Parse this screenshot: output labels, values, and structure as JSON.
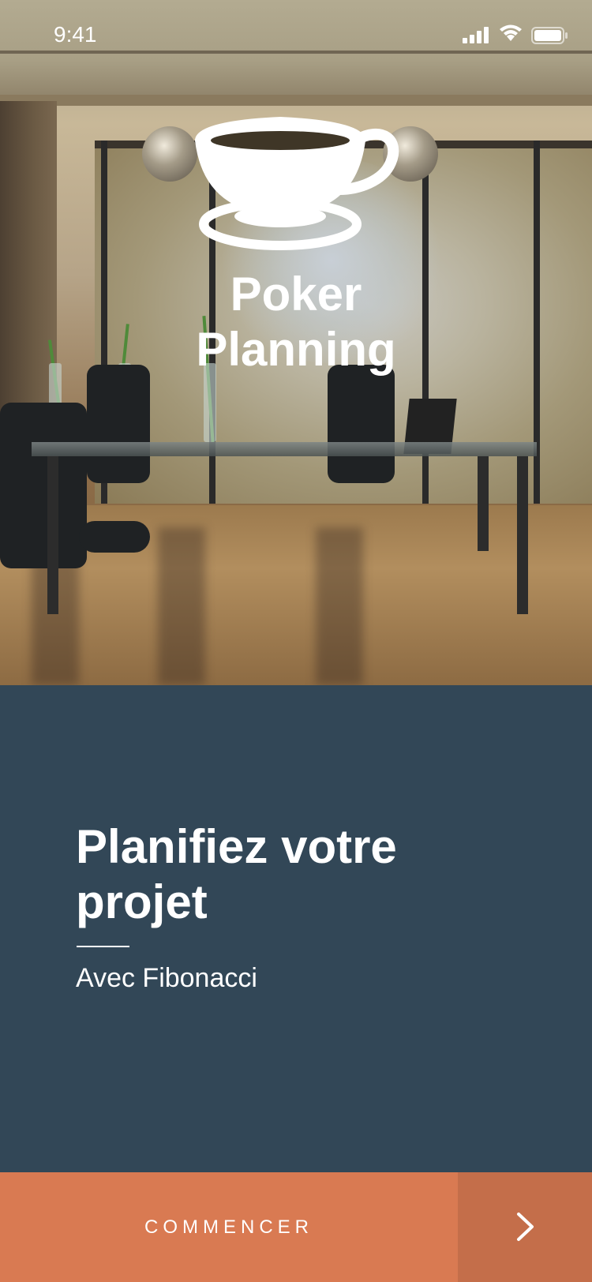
{
  "status_bar": {
    "time": "9:41",
    "icons": [
      "cellular-signal-icon",
      "wifi-icon",
      "battery-icon"
    ]
  },
  "hero": {
    "logo_icon": "coffee-cup-icon",
    "title_line1": "Poker",
    "title_line2": "Planning"
  },
  "content": {
    "headline_line1": "Planifiez votre",
    "headline_line2": "projet",
    "subtitle": "Avec Fibonacci"
  },
  "actions": {
    "start_label": "COMMENCER",
    "next_icon": "chevron-right-icon"
  },
  "colors": {
    "panel": "#324757",
    "button": "#d97a52",
    "button_secondary": "#c46e4a",
    "text": "#ffffff"
  }
}
